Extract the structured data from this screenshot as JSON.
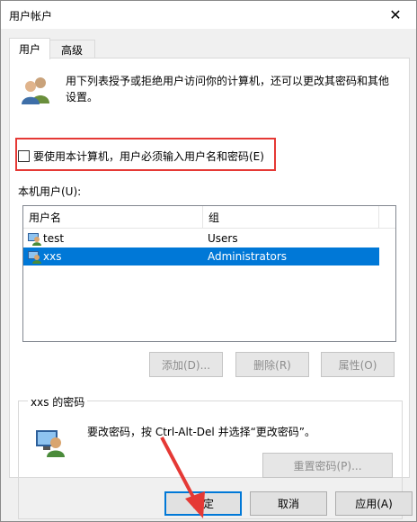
{
  "window": {
    "title": "用户帐户",
    "close_label": "✕"
  },
  "tabs": [
    {
      "label": "用户"
    },
    {
      "label": "高级"
    }
  ],
  "intro": {
    "text": "用下列表授予或拒绝用户访问你的计算机，还可以更改其密码和其他设置。"
  },
  "checkbox": {
    "label": "要使用本计算机，用户必须输入用户名和密码(E)",
    "checked": false
  },
  "users": {
    "label": "本机用户(U):",
    "columns": [
      "用户名",
      "组"
    ],
    "rows": [
      {
        "name": "test",
        "group": "Users"
      },
      {
        "name": "xxs",
        "group": "Administrators",
        "selected": true
      }
    ]
  },
  "user_buttons": {
    "add": "添加(D)...",
    "remove": "删除(R)",
    "properties": "属性(O)"
  },
  "password": {
    "group_title": "xxs 的密码",
    "text": "要改密码，按 Ctrl-Alt-Del 并选择“更改密码”。",
    "reset_button": "重置密码(P)..."
  },
  "footer": {
    "ok": "确定",
    "cancel": "取消",
    "apply": "应用(A)"
  },
  "colors": {
    "highlight": "#e53935",
    "selection": "#0078d7"
  }
}
